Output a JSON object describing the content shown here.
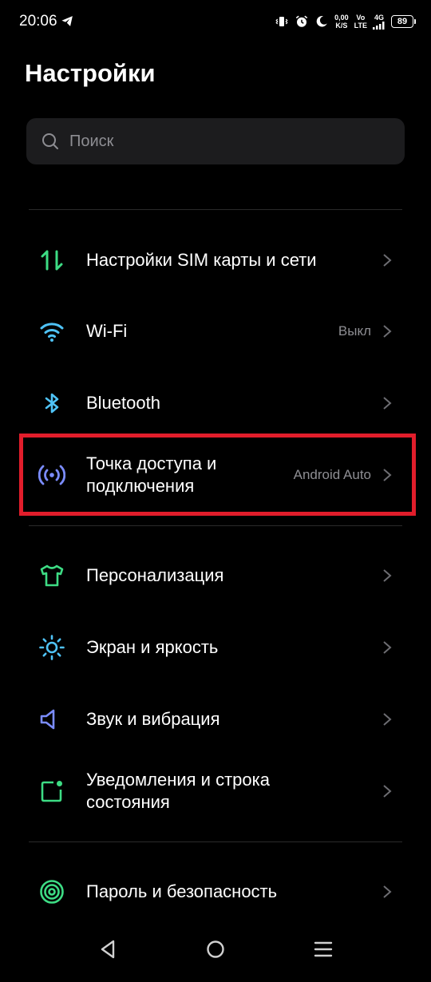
{
  "status_bar": {
    "time": "20:06",
    "net_speed_top": "0,00",
    "net_speed_bottom": "K/S",
    "volte_top": "Vo",
    "volte_bottom": "LTE",
    "network_type": "4G",
    "battery": "89"
  },
  "header": {
    "title": "Настройки"
  },
  "search": {
    "placeholder": "Поиск"
  },
  "settings": {
    "items": [
      {
        "label": "Настройки SIM карты и сети",
        "value": "",
        "icon": "sim-network-icon",
        "color": "#3ddc84"
      },
      {
        "label": "Wi-Fi",
        "value": "Выкл",
        "icon": "wifi-icon",
        "color": "#4fc3f7"
      },
      {
        "label": "Bluetooth",
        "value": "",
        "icon": "bluetooth-icon",
        "color": "#4fc3f7"
      },
      {
        "label": "Точка доступа и подключения",
        "value": "Android Auto",
        "icon": "hotspot-icon",
        "color": "#7b8cff"
      },
      {
        "label": "Персонализация",
        "value": "",
        "icon": "tshirt-icon",
        "color": "#3ddc84"
      },
      {
        "label": "Экран и яркость",
        "value": "",
        "icon": "brightness-icon",
        "color": "#4fc3f7"
      },
      {
        "label": "Звук и вибрация",
        "value": "",
        "icon": "speaker-icon",
        "color": "#7b8cff"
      },
      {
        "label": "Уведомления и строка состояния",
        "value": "",
        "icon": "notification-icon",
        "color": "#3ddc84"
      },
      {
        "label": "Пароль и безопасность",
        "value": "",
        "icon": "security-icon",
        "color": "#3ddc84"
      }
    ]
  },
  "colors": {
    "background": "#000000",
    "highlight": "#e11d2b",
    "secondary_text": "#8e8e93"
  }
}
